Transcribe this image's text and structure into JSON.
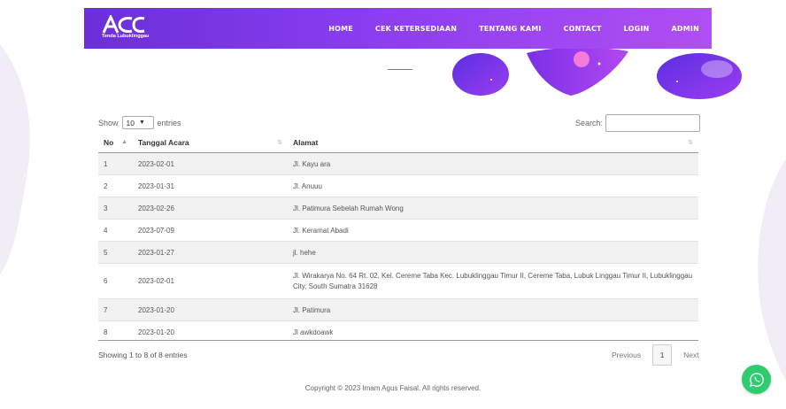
{
  "brand": {
    "logo_text": "ACC",
    "tagline": "Tenda Lubuklinggau"
  },
  "nav": {
    "items": [
      {
        "label": "HOME"
      },
      {
        "label": "CEK KETERSEDIAAN"
      },
      {
        "label": "TENTANG KAMI"
      },
      {
        "label": "CONTACT"
      },
      {
        "label": "LOGIN"
      },
      {
        "label": "ADMIN"
      }
    ]
  },
  "colors": {
    "accent": "#8a3df0",
    "whatsapp": "#2fcc6f"
  },
  "table_controls": {
    "show_label": "Show",
    "length_value": "10",
    "entries_label": "entries",
    "search_label": "Search:",
    "search_value": ""
  },
  "table": {
    "headers": [
      "No",
      "Tanggal Acara",
      "Alamat"
    ],
    "rows": [
      {
        "no": "1",
        "tanggal": "2023-02-01",
        "alamat": "Jl. Kayu ara"
      },
      {
        "no": "2",
        "tanggal": "2023-01-31",
        "alamat": "Jl. Anuuu"
      },
      {
        "no": "3",
        "tanggal": "2023-02-26",
        "alamat": "Jl. Patimura Sebelah Rumah Wong"
      },
      {
        "no": "4",
        "tanggal": "2023-07-09",
        "alamat": "Jl. Keramat Abadi"
      },
      {
        "no": "5",
        "tanggal": "2023-01-27",
        "alamat": "jl. hehe"
      },
      {
        "no": "6",
        "tanggal": "2023-02-01",
        "alamat": "Jl. Wirakarya No. 64 Rt. 02, Kel. Cereme Taba Kec. Lubuklinggau Timur II, Cereme Taba, Lubuk Linggau Timur II, Lubuklinggau City, South Sumatra 31628"
      },
      {
        "no": "7",
        "tanggal": "2023-01-20",
        "alamat": "Jl. Patimura"
      },
      {
        "no": "8",
        "tanggal": "2023-01-20",
        "alamat": "Jl awkdoawk"
      }
    ]
  },
  "pagination": {
    "info": "Showing 1 to 8 of 8 entries",
    "previous": "Previous",
    "current": "1",
    "next": "Next"
  },
  "footer": {
    "copyright": "Copyright © 2023 Imam Agus Faisal. All rights reserved."
  }
}
